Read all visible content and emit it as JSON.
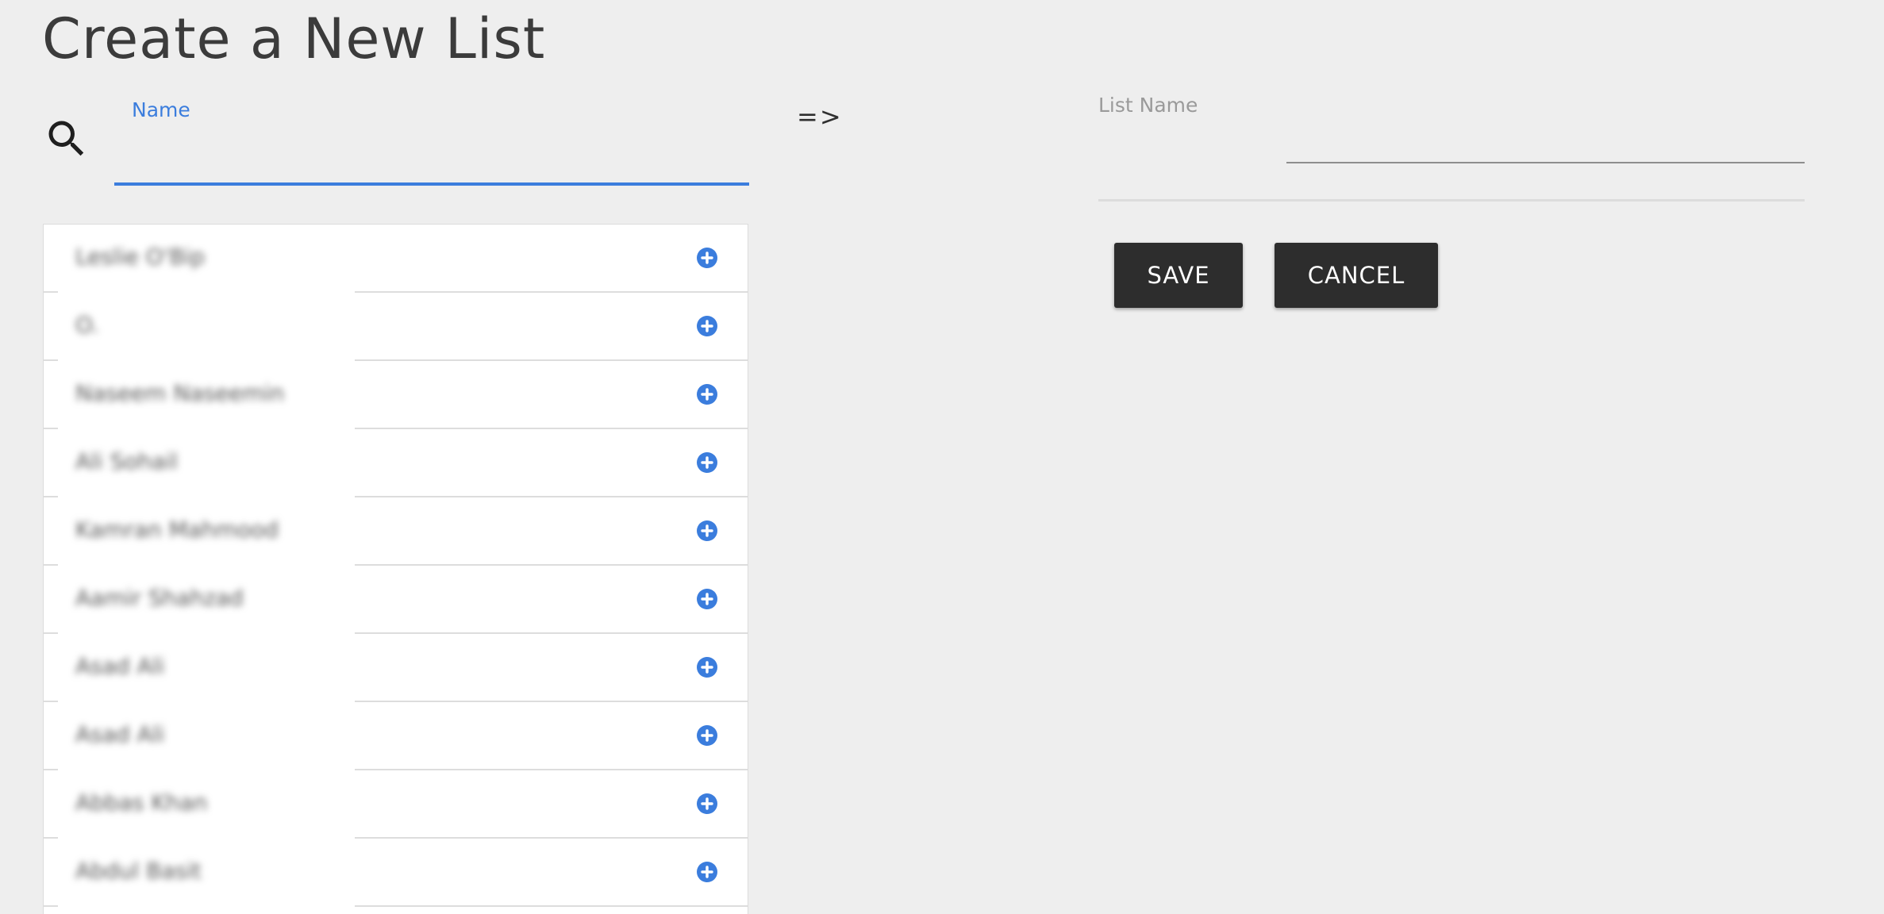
{
  "page": {
    "title": "Create a New List",
    "arrow": "=>"
  },
  "search": {
    "label": "Name",
    "value": "",
    "placeholder": ""
  },
  "people": {
    "items": [
      {
        "name": "Leslie O'Bip"
      },
      {
        "name": "O."
      },
      {
        "name": "Naseem Naseemin"
      },
      {
        "name": "Ali Sohail"
      },
      {
        "name": "Kamran Mahmood"
      },
      {
        "name": "Aamir Shahzad"
      },
      {
        "name": "Asad Ali"
      },
      {
        "name": "Asad Ali"
      },
      {
        "name": "Abbas Khan"
      },
      {
        "name": "Abdul Basit"
      }
    ]
  },
  "form": {
    "list_name_label": "List Name",
    "list_name_value": "",
    "save_label": "SAVE",
    "cancel_label": "CANCEL"
  },
  "colors": {
    "accent": "#3b7ddd",
    "button_bg": "#2d2d2d",
    "background": "#eeeeee"
  },
  "icons": {
    "search": "search-icon",
    "add": "plus-circle-icon"
  }
}
